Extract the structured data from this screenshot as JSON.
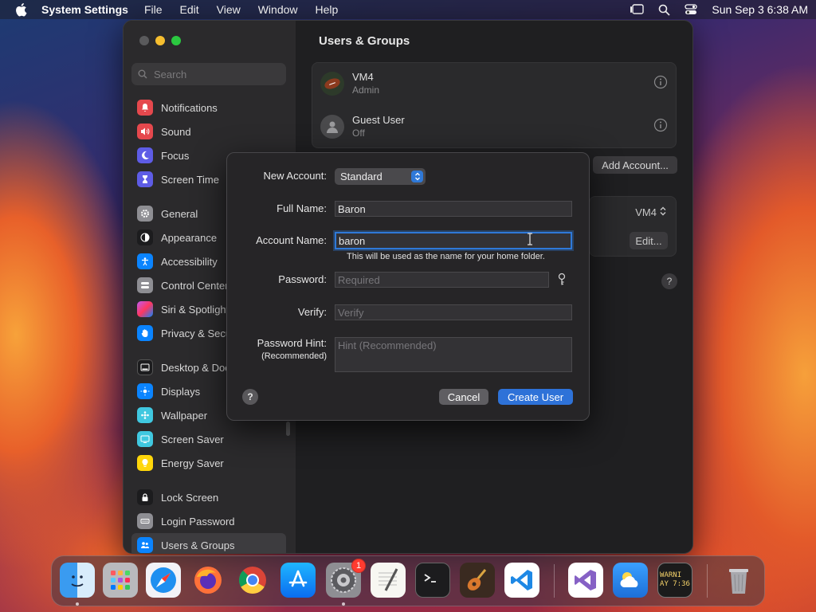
{
  "menubar": {
    "app_name": "System Settings",
    "menus": [
      "File",
      "Edit",
      "View",
      "Window",
      "Help"
    ],
    "clock": "Sun Sep 3  6:38 AM"
  },
  "sidebar": {
    "search_placeholder": "Search",
    "groups": [
      [
        {
          "label": "Notifications",
          "icon": "bell-icon",
          "color": "#e5484d"
        },
        {
          "label": "Sound",
          "icon": "speaker-icon",
          "color": "#e5484d"
        },
        {
          "label": "Focus",
          "icon": "moon-icon",
          "color": "#5e5ce6"
        },
        {
          "label": "Screen Time",
          "icon": "hourglass-icon",
          "color": "#5e5ce6"
        }
      ],
      [
        {
          "label": "General",
          "icon": "gear-icon",
          "color": "#8e8e93"
        },
        {
          "label": "Appearance",
          "icon": "appearance-icon",
          "color": "#1c1c1e"
        },
        {
          "label": "Accessibility",
          "icon": "accessibility-icon",
          "color": "#0a84ff"
        },
        {
          "label": "Control Center",
          "icon": "control-center-icon",
          "color": "#8e8e93"
        },
        {
          "label": "Siri & Spotlight",
          "icon": "siri-icon",
          "color": "#bf5af2"
        },
        {
          "label": "Privacy & Security",
          "icon": "hand-icon",
          "color": "#0a84ff"
        }
      ],
      [
        {
          "label": "Desktop & Dock",
          "icon": "dock-icon",
          "color": "#1c1c1e"
        },
        {
          "label": "Displays",
          "icon": "sun-icon",
          "color": "#0a84ff"
        },
        {
          "label": "Wallpaper",
          "icon": "wallpaper-icon",
          "color": "#40c8e0"
        },
        {
          "label": "Screen Saver",
          "icon": "screensaver-icon",
          "color": "#40c8e0"
        },
        {
          "label": "Energy Saver",
          "icon": "bulb-icon",
          "color": "#ffd60a"
        }
      ],
      [
        {
          "label": "Lock Screen",
          "icon": "lock-icon",
          "color": "#1c1c1e"
        },
        {
          "label": "Login Password",
          "icon": "password-icon",
          "color": "#8e8e93"
        },
        {
          "label": "Users & Groups",
          "icon": "users-icon",
          "color": "#0a84ff",
          "selected": true
        }
      ]
    ]
  },
  "main": {
    "title": "Users & Groups",
    "users": [
      {
        "name": "VM4",
        "role": "Admin"
      },
      {
        "name": "Guest User",
        "role": "Off"
      }
    ],
    "add_account_label": "Add Account...",
    "auto_login_value": "VM4",
    "edit_label": "Edit...",
    "help_label": "?"
  },
  "dialog": {
    "new_account_label": "New Account:",
    "account_type": "Standard",
    "full_name_label": "Full Name:",
    "full_name_value": "Baron",
    "account_name_label": "Account Name:",
    "account_name_value": "baron",
    "account_name_note": "This will be used as the name for your home folder.",
    "password_label": "Password:",
    "password_placeholder": "Required",
    "verify_label": "Verify:",
    "verify_placeholder": "Verify",
    "hint_label": "Password Hint:",
    "hint_sublabel": "(Recommended)",
    "hint_placeholder": "Hint (Recommended)",
    "help_label": "?",
    "cancel_label": "Cancel",
    "create_label": "Create User"
  },
  "dock": {
    "settings_badge": "1",
    "console_text": [
      "WARNI",
      "AY 7:36"
    ]
  },
  "colors": {
    "accent": "#2e72d8"
  }
}
